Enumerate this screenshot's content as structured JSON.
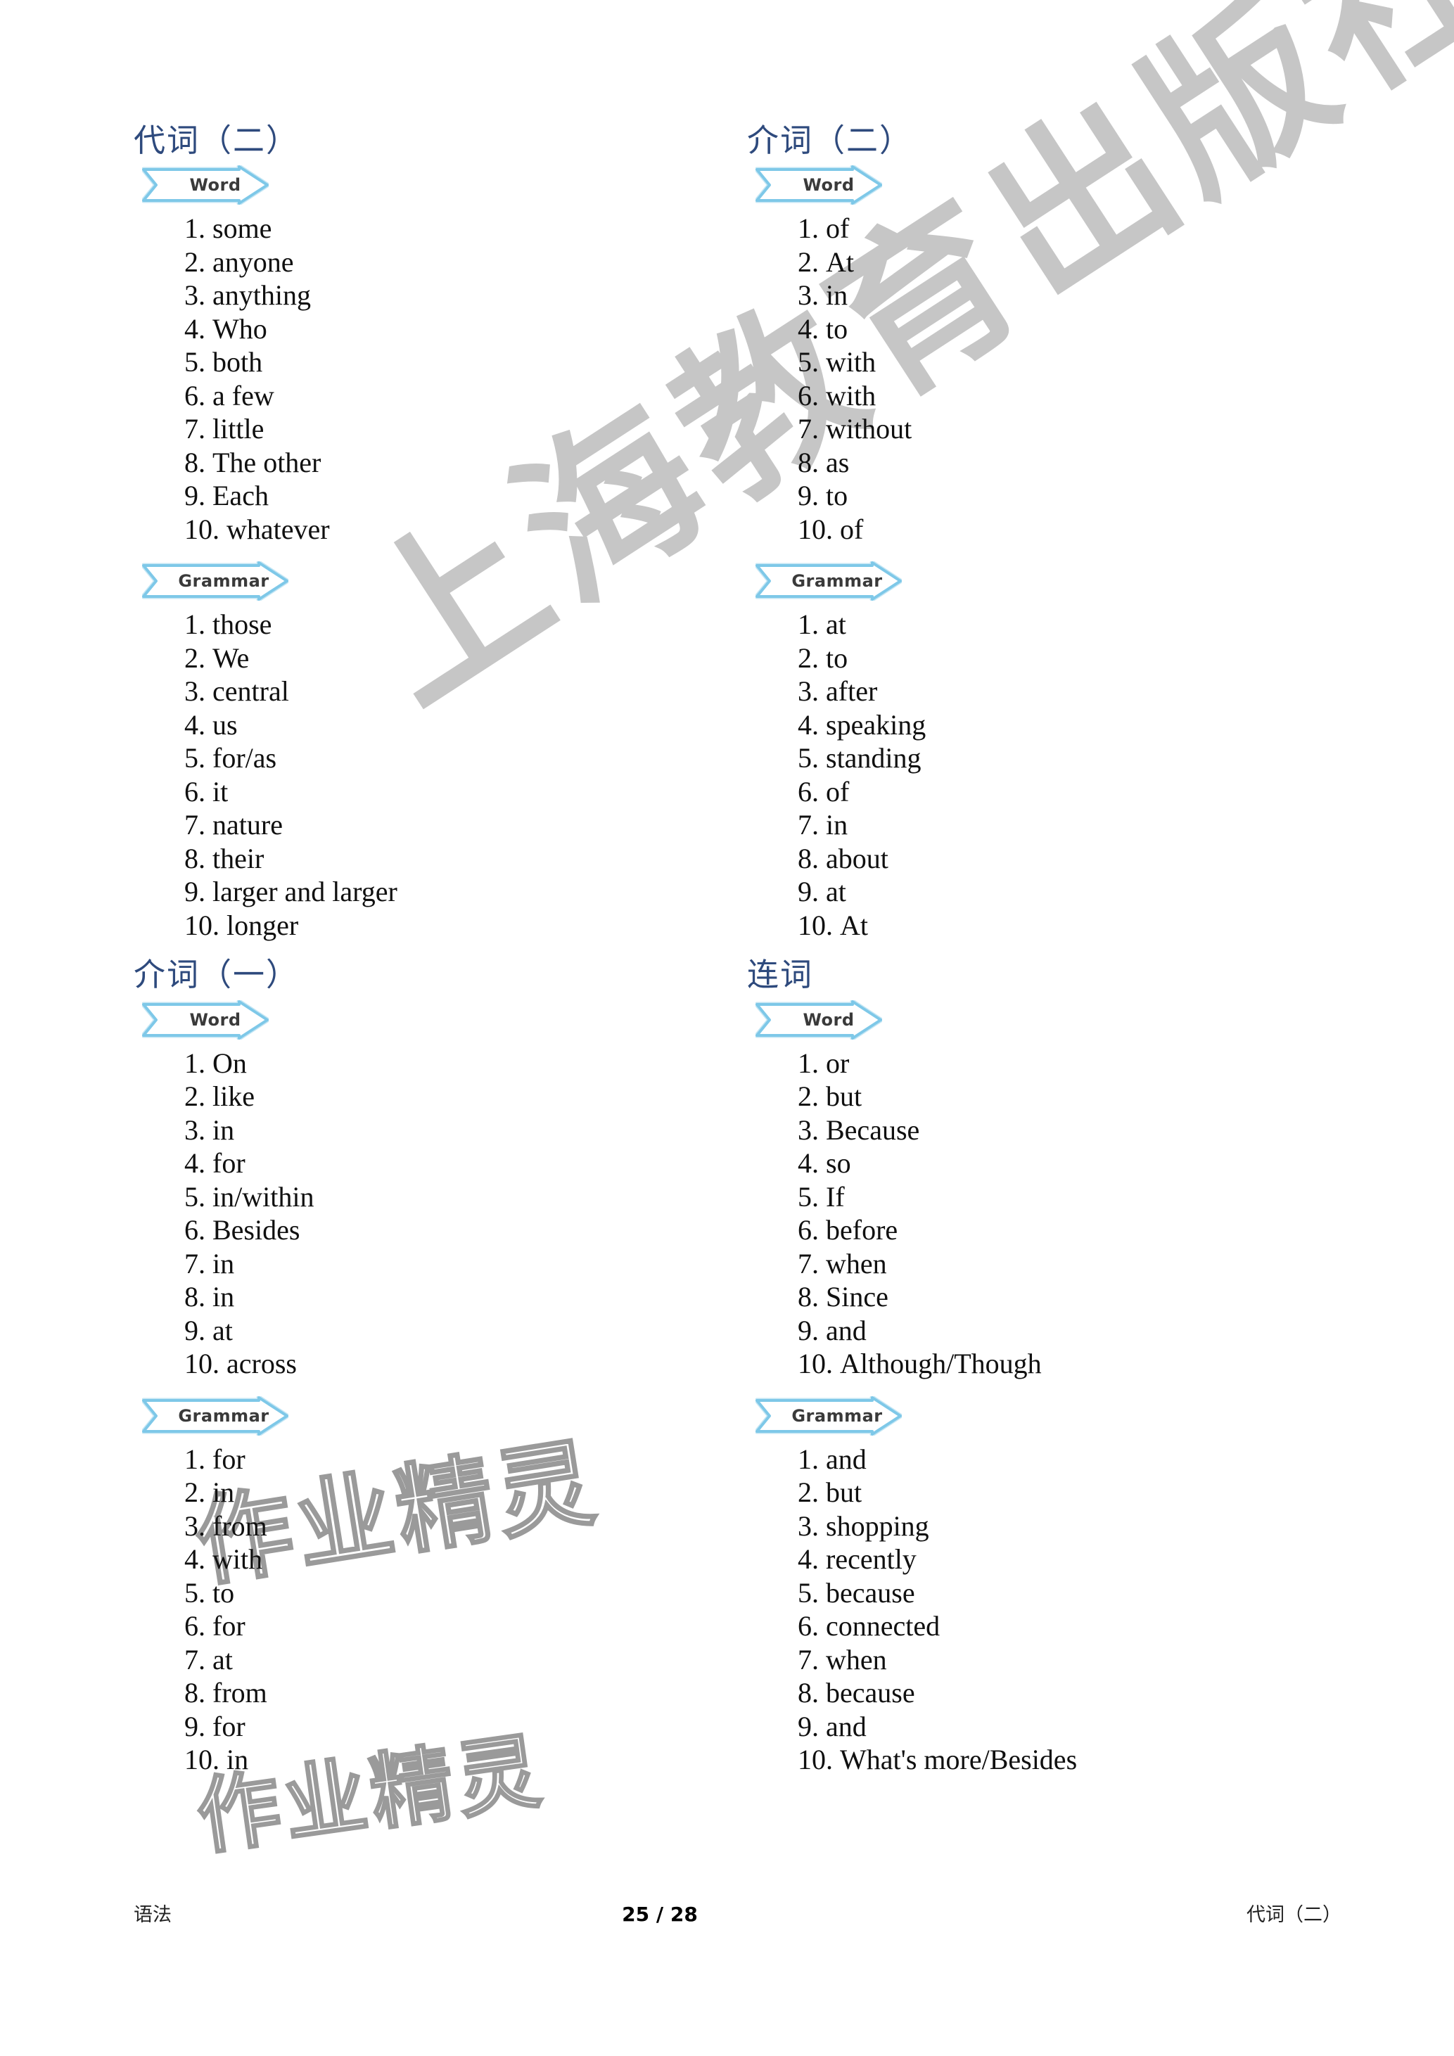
{
  "document": {
    "banner_word_label": "Word",
    "banner_grammar_label": "Grammar",
    "heading_color": "#2e4a7d",
    "banner_color": "#7ec8e8"
  },
  "watermarks": {
    "publisher": "上海教育出版社",
    "outline_1": "作业精灵",
    "outline_2": "作业精灵"
  },
  "columns": {
    "left": [
      {
        "heading": "代词（二）",
        "blocks": [
          {
            "label": "Word",
            "items": [
              {
                "num": "1.",
                "text": "some"
              },
              {
                "num": "2.",
                "text": "anyone"
              },
              {
                "num": "3.",
                "text": "anything"
              },
              {
                "num": "4.",
                "text": "Who"
              },
              {
                "num": "5.",
                "text": "both"
              },
              {
                "num": "6.",
                "text": "a few"
              },
              {
                "num": "7.",
                "text": "little"
              },
              {
                "num": "8.",
                "text": "The other"
              },
              {
                "num": "9.",
                "text": "Each"
              },
              {
                "num": "10.",
                "text": "whatever"
              }
            ]
          },
          {
            "label": "Grammar",
            "items": [
              {
                "num": "1.",
                "text": "those"
              },
              {
                "num": "2.",
                "text": "We"
              },
              {
                "num": "3.",
                "text": "central"
              },
              {
                "num": "4.",
                "text": "us"
              },
              {
                "num": "5.",
                "text": "for/as"
              },
              {
                "num": "6.",
                "text": "it"
              },
              {
                "num": "7.",
                "text": "nature"
              },
              {
                "num": "8.",
                "text": "their"
              },
              {
                "num": "9.",
                "text": "larger and larger"
              },
              {
                "num": "10.",
                "text": "longer"
              }
            ]
          }
        ]
      },
      {
        "heading": "介词（一）",
        "blocks": [
          {
            "label": "Word",
            "items": [
              {
                "num": "1.",
                "text": "On"
              },
              {
                "num": "2.",
                "text": "like"
              },
              {
                "num": "3.",
                "text": "in"
              },
              {
                "num": "4.",
                "text": "for"
              },
              {
                "num": "5.",
                "text": "in/within"
              },
              {
                "num": "6.",
                "text": "Besides"
              },
              {
                "num": "7.",
                "text": "in"
              },
              {
                "num": "8.",
                "text": "in"
              },
              {
                "num": "9.",
                "text": "at"
              },
              {
                "num": "10.",
                "text": "across"
              }
            ]
          },
          {
            "label": "Grammar",
            "items": [
              {
                "num": "1.",
                "text": "for"
              },
              {
                "num": "2.",
                "text": "in"
              },
              {
                "num": "3.",
                "text": "from"
              },
              {
                "num": "4.",
                "text": "with"
              },
              {
                "num": "5.",
                "text": "to"
              },
              {
                "num": "6.",
                "text": "for"
              },
              {
                "num": "7.",
                "text": "at"
              },
              {
                "num": "8.",
                "text": "from"
              },
              {
                "num": "9.",
                "text": "for"
              },
              {
                "num": "10.",
                "text": "in"
              }
            ]
          }
        ]
      }
    ],
    "right": [
      {
        "heading": "介词（二）",
        "blocks": [
          {
            "label": "Word",
            "items": [
              {
                "num": "1.",
                "text": "of"
              },
              {
                "num": "2.",
                "text": "At"
              },
              {
                "num": "3.",
                "text": "in"
              },
              {
                "num": "4.",
                "text": "to"
              },
              {
                "num": "5.",
                "text": "with"
              },
              {
                "num": "6.",
                "text": "with"
              },
              {
                "num": "7.",
                "text": "without"
              },
              {
                "num": "8.",
                "text": "as"
              },
              {
                "num": "9.",
                "text": "to"
              },
              {
                "num": "10.",
                "text": "of"
              }
            ]
          },
          {
            "label": "Grammar",
            "items": [
              {
                "num": "1.",
                "text": "at"
              },
              {
                "num": "2.",
                "text": "to"
              },
              {
                "num": "3.",
                "text": "after"
              },
              {
                "num": "4.",
                "text": "speaking"
              },
              {
                "num": "5.",
                "text": "standing"
              },
              {
                "num": "6.",
                "text": "of"
              },
              {
                "num": "7.",
                "text": "in"
              },
              {
                "num": "8.",
                "text": "about"
              },
              {
                "num": "9.",
                "text": "at"
              },
              {
                "num": "10.",
                "text": "At"
              }
            ]
          }
        ]
      },
      {
        "heading": "连词",
        "blocks": [
          {
            "label": "Word",
            "items": [
              {
                "num": "1.",
                "text": "or"
              },
              {
                "num": "2.",
                "text": "but"
              },
              {
                "num": "3.",
                "text": "Because"
              },
              {
                "num": "4.",
                "text": "so"
              },
              {
                "num": "5.",
                "text": "If"
              },
              {
                "num": "6.",
                "text": "before"
              },
              {
                "num": "7.",
                "text": "when"
              },
              {
                "num": "8.",
                "text": "Since"
              },
              {
                "num": "9.",
                "text": "and"
              },
              {
                "num": "10.",
                "text": "Although/Though"
              }
            ]
          },
          {
            "label": "Grammar",
            "items": [
              {
                "num": "1.",
                "text": "and"
              },
              {
                "num": "2.",
                "text": "but"
              },
              {
                "num": "3.",
                "text": "shopping"
              },
              {
                "num": "4.",
                "text": "recently"
              },
              {
                "num": "5.",
                "text": "because"
              },
              {
                "num": "6.",
                "text": "connected"
              },
              {
                "num": "7.",
                "text": "when"
              },
              {
                "num": "8.",
                "text": "because"
              },
              {
                "num": "9.",
                "text": "and"
              },
              {
                "num": "10.",
                "text": "What's more/Besides"
              }
            ]
          }
        ]
      }
    ]
  },
  "footer": {
    "left": "语法",
    "center": "25 / 28",
    "right": "代词（二）"
  }
}
